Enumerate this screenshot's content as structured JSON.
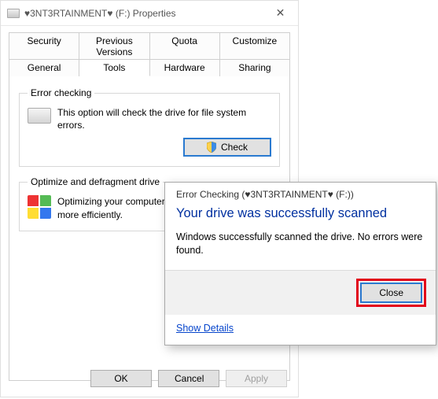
{
  "properties": {
    "title": "♥3NT3RTAINMENT♥ (F:) Properties",
    "tabs_row1": [
      "Security",
      "Previous Versions",
      "Quota",
      "Customize"
    ],
    "tabs_row2": [
      "General",
      "Tools",
      "Hardware",
      "Sharing"
    ],
    "active_tab": "Tools",
    "error_checking": {
      "legend": "Error checking",
      "desc": "This option will check the drive for file system errors.",
      "button": "Check"
    },
    "optimize": {
      "legend": "Optimize and defragment drive",
      "desc": "Optimizing your computer's drives can help it run more efficiently."
    },
    "footer": {
      "ok": "OK",
      "cancel": "Cancel",
      "apply": "Apply"
    }
  },
  "dialog": {
    "title": "Error Checking (♥3NT3RTAINMENT♥ (F:))",
    "heading": "Your drive was successfully scanned",
    "body": "Windows successfully scanned the drive. No errors were found.",
    "close": "Close",
    "details": "Show Details"
  }
}
